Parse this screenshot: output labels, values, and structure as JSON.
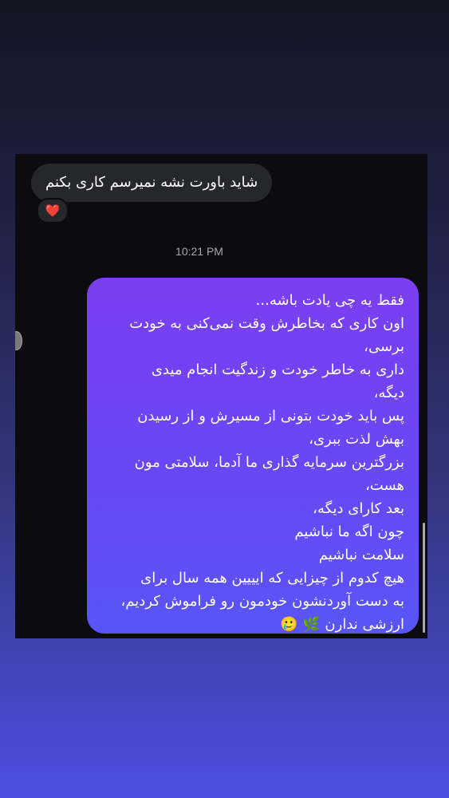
{
  "chat": {
    "received_message": "شاید باورت نشه نمیرسم کاری بکنم",
    "reaction": "❤️",
    "timestamp": "10:21 PM",
    "sent_lines": [
      "فقط یه چی یادت باشه...",
      "اون کاری که بخاطرش وقت نمی‌کنی به خودت",
      "برسی،",
      "داری به خاطر خودت و زندگیت انجام میدی",
      "دیگه،",
      "پس باید خودت بتونی از مسیرش و از رسیدن",
      "بهش لذت ببری،",
      "بزرگترین سرمایه گذاری ما آدما، سلامتی مون",
      "هست،",
      "بعد کارای دیگه،",
      "چون اگه ما نباشیم",
      "سلامت نباشیم",
      "هیچ کدوم از چیزایی که ایییین همه سال برای",
      "به دست آوردنشون خودمون رو فراموش کردیم،",
      "ارزشی ندارن 🌿 🥲"
    ]
  },
  "colors": {
    "received_bubble": "#26272b",
    "sent_bubble_top": "#7b3ff0",
    "sent_bubble_bottom": "#5855f6",
    "chat_background": "#0b0b10"
  }
}
